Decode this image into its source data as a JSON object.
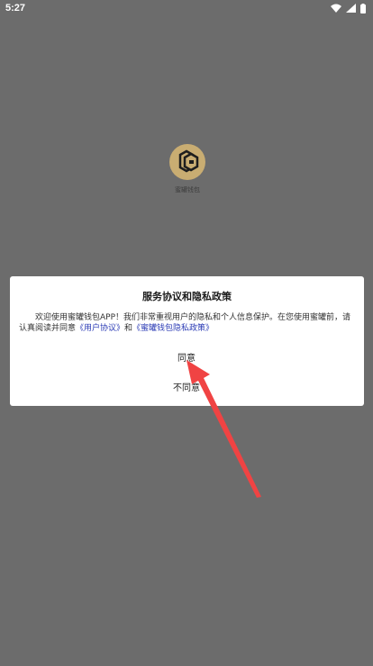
{
  "status_bar": {
    "time": "5:27"
  },
  "splash": {
    "app_name": "蜜罐钱包",
    "logo_color": "#c9ad72"
  },
  "dialog": {
    "title": "服务协议和隐私政策",
    "body_text_1": "欢迎使用蜜罐钱包APP！我们非常重视用户的隐私和个人信息保护。在您使用蜜罐前，请认真阅读并同意",
    "user_agreement_link": "《用户协议》",
    "and_text": "和",
    "privacy_policy_link": "《蜜罐钱包隐私政策》",
    "agree_label": "同意",
    "disagree_label": "不同意",
    "link_color": "#2b3bb5"
  },
  "annotation": {
    "arrow_color": "#f04343"
  }
}
